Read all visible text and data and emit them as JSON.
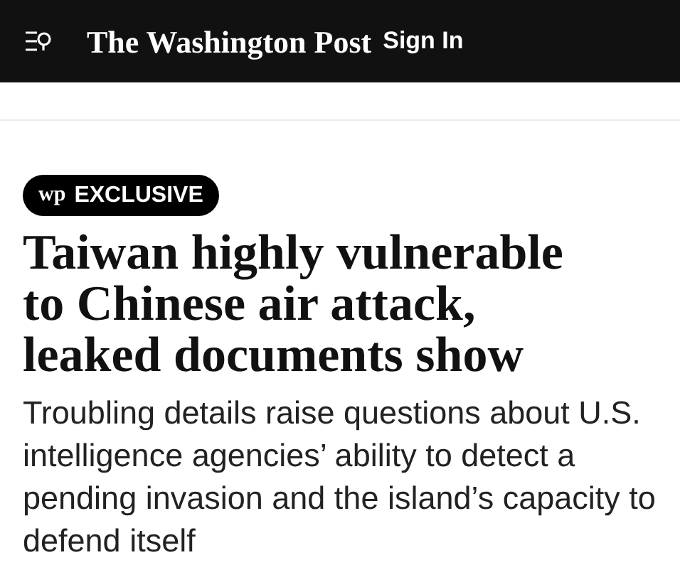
{
  "header": {
    "logo": "The Washington Post",
    "sign_in": "Sign In"
  },
  "article": {
    "badge": {
      "mark": "wp",
      "label": "EXCLUSIVE"
    },
    "headline": "Taiwan highly vulnerable to Chinese air attack, leaked documents show",
    "subheadline": "Troubling details raise questions about U.S. intelligence agencies’ ability to detect a pending invasion and the island’s capacity to defend itself"
  }
}
